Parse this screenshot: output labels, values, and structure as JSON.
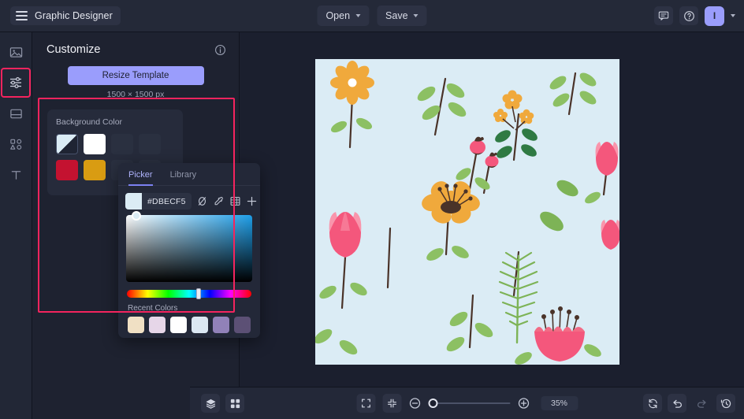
{
  "topbar": {
    "brand_title": "Graphic Designer",
    "menu_icon": "hamburger-icon",
    "open_label": "Open",
    "save_label": "Save",
    "chat_icon": "chat-bubble-icon",
    "help_icon": "help-circle-icon",
    "avatar_initial": "I",
    "accent_purple": "#9a9dfc"
  },
  "rail": {
    "items": [
      {
        "name": "image-tool",
        "icon": "image-icon",
        "active": false
      },
      {
        "name": "adjust-tool",
        "icon": "sliders-icon",
        "active": true
      },
      {
        "name": "layout-tool",
        "icon": "layout-icon",
        "active": false
      },
      {
        "name": "shapes-tool",
        "icon": "shapes-icon",
        "active": false
      },
      {
        "name": "text-tool",
        "icon": "text-icon",
        "active": false
      }
    ],
    "highlight_color": "#f4245e"
  },
  "panel": {
    "title": "Customize",
    "info_icon": "info-icon",
    "resize_label": "Resize Template",
    "dimensions": "1500 × 1500 px",
    "background_color_label": "Background Color",
    "swatches": [
      {
        "name": "swatch-transparent",
        "color": "#dbecf5"
      },
      {
        "name": "swatch-white",
        "color": "#ffffff"
      },
      {
        "name": "swatch-red",
        "color": "#c41230"
      },
      {
        "name": "swatch-gold",
        "color": "#d99c12"
      }
    ]
  },
  "picker": {
    "tab_picker": "Picker",
    "tab_library": "Library",
    "hex_value": "#DBECF5",
    "current_color": "#dbecf5",
    "tools": [
      {
        "name": "no-color-icon",
        "label": "no-color"
      },
      {
        "name": "eyedropper-icon",
        "label": "eyedropper"
      },
      {
        "name": "grid-icon",
        "label": "grid"
      },
      {
        "name": "add-color-icon",
        "label": "add"
      }
    ],
    "recent_label": "Recent Colors",
    "recent_colors": [
      "#f0e0c4",
      "#e6d6e8",
      "#ffffff",
      "#dbe7f2",
      "#9181b8",
      "#5c5075"
    ]
  },
  "canvas": {
    "background_color": "#dbecf5",
    "palette": {
      "orange": "#f0a93c",
      "dark_orange": "#e89c2b",
      "pink": "#f4577c",
      "light_pink": "#f995ac",
      "rose": "#f26b85",
      "green_light": "#8cc063",
      "green_mid": "#7db356",
      "green_dark": "#2f7a43",
      "stem": "#4a3329",
      "seed": "#4a3329"
    }
  },
  "bottombar": {
    "layers_icon": "layers-icon",
    "grid_icon": "grid-view-icon",
    "fullscreen_icon": "expand-icon",
    "fitscreen_icon": "collapse-icon",
    "zoom_out_icon": "minus-circle-icon",
    "zoom_in_icon": "plus-circle-icon",
    "zoom_level": "35%",
    "sync_icon": "sync-icon",
    "undo_icon": "undo-icon",
    "redo_icon": "redo-icon",
    "history_icon": "history-icon"
  }
}
